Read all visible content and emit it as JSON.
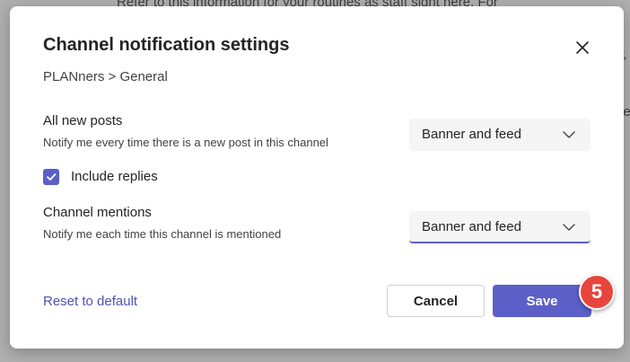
{
  "background": {
    "lines": [
      "Refer to this information for your routines as staff sight here. For",
      "y,",
      "de"
    ]
  },
  "dialog": {
    "title": "Channel notification settings",
    "breadcrumb": "PLANners > General",
    "close_icon": "close-icon"
  },
  "settings": {
    "all_posts": {
      "title": "All new posts",
      "description": "Notify me every time there is a new post in this channel",
      "value": "Banner and feed"
    },
    "include_replies": {
      "label": "Include replies",
      "checked": true
    },
    "channel_mentions": {
      "title": "Channel mentions",
      "description": "Notify me each time this channel is mentioned",
      "value": "Banner and feed"
    }
  },
  "footer": {
    "reset_label": "Reset to default",
    "cancel_label": "Cancel",
    "save_label": "Save"
  },
  "step_badge": "5",
  "colors": {
    "accent": "#5b5fc7",
    "link": "#4f52b2",
    "badge": "#e8453c"
  }
}
